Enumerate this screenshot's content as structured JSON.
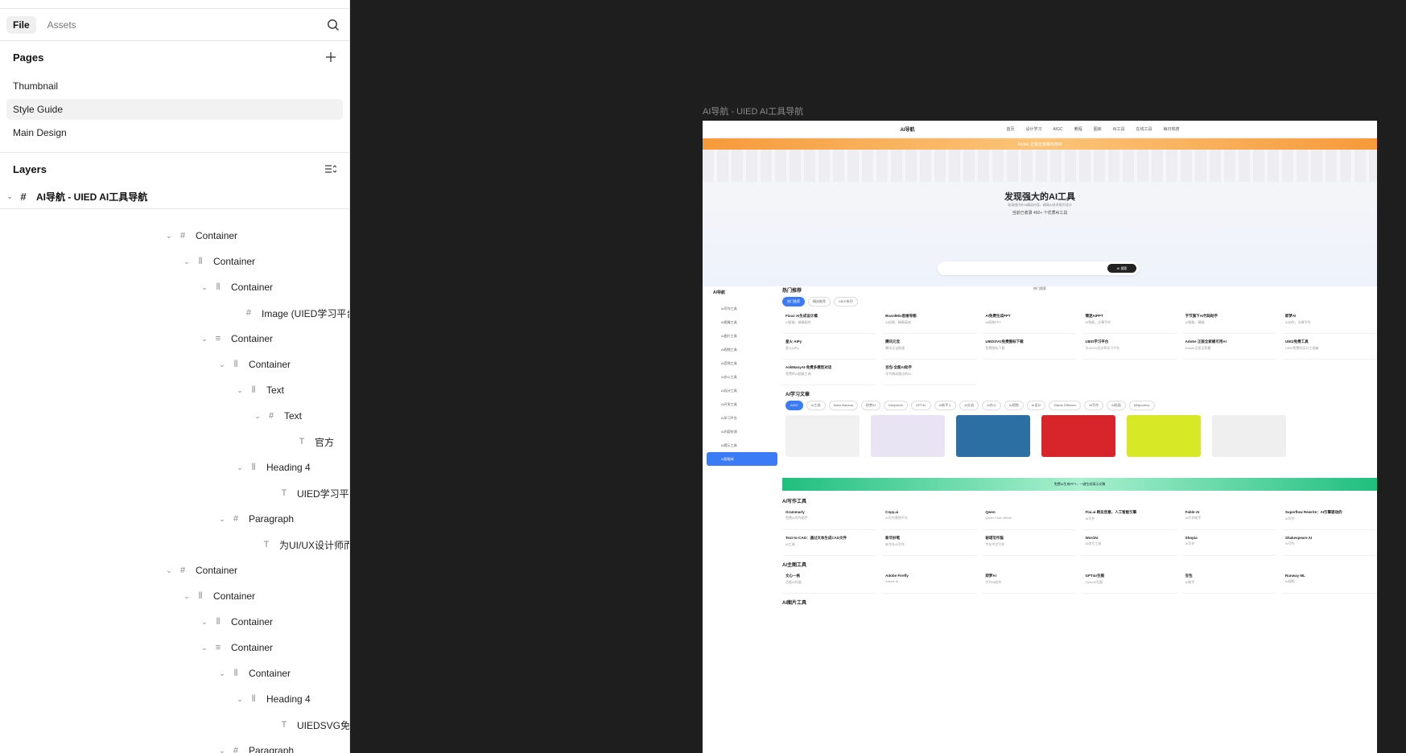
{
  "sidebar": {
    "tabs": [
      {
        "label": "File",
        "active": true
      },
      {
        "label": "Assets",
        "active": false
      }
    ],
    "pages": {
      "title": "Pages",
      "items": [
        {
          "label": "Thumbnail",
          "active": false
        },
        {
          "label": "Style Guide",
          "active": true
        },
        {
          "label": "Main Design",
          "active": false
        }
      ]
    },
    "layers": {
      "title": "Layers",
      "root": "AI导航 - UIED AI工具导航",
      "rows": [
        {
          "label": "Container",
          "icon": "frame-icon"
        },
        {
          "label": "Container",
          "icon": "autolayout-h-icon"
        },
        {
          "label": "Container",
          "icon": "autolayout-h-icon"
        },
        {
          "label": "Image (UIED学习平台",
          "icon": "frame-icon"
        },
        {
          "label": "Container",
          "icon": "autolayout-v-icon"
        },
        {
          "label": "Container",
          "icon": "autolayout-h-icon"
        },
        {
          "label": "Text",
          "icon": "autolayout-h-icon"
        },
        {
          "label": "Text",
          "icon": "frame-icon"
        },
        {
          "label": "官方",
          "icon": "text-icon"
        },
        {
          "label": "Heading 4",
          "icon": "autolayout-h-icon"
        },
        {
          "label": "UIED学习平",
          "icon": "text-icon"
        },
        {
          "label": "Paragraph",
          "icon": "frame-icon"
        },
        {
          "label": "为UI/UX设计师而",
          "icon": "text-icon"
        },
        {
          "label": "Container",
          "icon": "frame-icon"
        },
        {
          "label": "Container",
          "icon": "autolayout-h-icon"
        },
        {
          "label": "Container",
          "icon": "autolayout-h-icon"
        },
        {
          "label": "Container",
          "icon": "autolayout-v-icon"
        },
        {
          "label": "Container",
          "icon": "autolayout-h-icon"
        },
        {
          "label": "Heading 4",
          "icon": "autolayout-h-icon"
        },
        {
          "label": "UIEDSVG免",
          "icon": "text-icon"
        },
        {
          "label": "Paragraph",
          "icon": "frame-icon"
        }
      ]
    }
  },
  "canvas": {
    "frame_label": "AI导航 - UIED AI工具导航",
    "site": {
      "logo": "AI导航",
      "nav": [
        "首页",
        "设计学习",
        "AIGC",
        "教程",
        "图库",
        "AI工具",
        "在线工具",
        "每日热搜"
      ],
      "banner": "Adobe 正版全家桶可用AI",
      "hero_title": "发现强大的AI工具",
      "hero_sub": "收录国内外AI精选内容，精致AI技术助力设计",
      "hero_count": "当前已收录 492+ 个优质AI工具",
      "search_btn": "AI 搜索",
      "hot_label": "热门搜索",
      "side_title": "AI导航",
      "side_items": [
        "AI写作工具",
        "AI图像工具",
        "AI图片工具",
        "AI视频工具",
        "AI音频工具",
        "AI办公工具",
        "AI设计工具",
        "AI开发工具",
        "AI学习平台",
        "AI内容检测",
        "AI提示工具",
        "AI智能体"
      ],
      "sec_hot": "热门推荐",
      "sec_hot_chips": [
        "热门推荐",
        "精选推荐",
        "UIED系列"
      ],
      "hot_cards": [
        {
          "t": "Fixxo AI生成设计稿",
          "d": "AI智能，精确配色"
        },
        {
          "t": "BoardMix思维导图",
          "d": "AI创建，精确高效"
        },
        {
          "t": "AI免费生成PPT",
          "d": "AI高效PPT"
        },
        {
          "t": "情迷AIPPT",
          "d": "AI智能，文章写作"
        },
        {
          "t": "字节旗下AI代码助手",
          "d": "AI智能，精确"
        },
        {
          "t": "即梦AI",
          "d": "AI创作，文章写作"
        },
        {
          "t": "星火 AIPy",
          "d": "星火AIPy"
        },
        {
          "t": "腾讯元宝",
          "d": "腾讯元宝助理"
        },
        {
          "t": "UIEDSVG免费图标下载",
          "d": "免费图标下载"
        },
        {
          "t": "UIED学习平台",
          "d": "为UI/UX设计师学习平台"
        },
        {
          "t": "Adobe 正版全家桶可用AI",
          "d": "Adobe正版全家桶"
        },
        {
          "t": "UIED免费工具",
          "d": "UIED免费的设计工具箱"
        },
        {
          "t": "AskManyAI-免费多模型对话",
          "d": "免费的AI超级工具"
        },
        {
          "t": "豆包-全能AI助手",
          "d": "字节跳动推出的AI"
        }
      ],
      "sec_learn": "AI学习文章",
      "sec_learn_chips": [
        "AIGC",
        "AI工具",
        "Nano Banana",
        "即梦AI",
        "Deepseek",
        "GPT4o",
        "AI新手入",
        "AI交流",
        "AI办公",
        "AI视频",
        "AI设计",
        "Stable Diffusion",
        "AI写作",
        "AI绘画",
        "Midjourney"
      ],
      "thumb_colors": [
        "#f1f1f1",
        "#e8e4f4",
        "#2c6fa3",
        "#d8252b",
        "#d7e826",
        "#efefef"
      ],
      "green_banner": "免费AI生成PPT，一键生成演示文稿",
      "sec_write": "AI写作工具",
      "write_cards": [
        {
          "t": "Grammarly",
          "d": "免费AI写作助手"
        },
        {
          "t": "Copy.ai",
          "d": "AI写作营销平台"
        },
        {
          "t": "Qwen",
          "d": "Qwen Chat official"
        },
        {
          "t": "Flai.ai·跨友创意、人工智能引擎",
          "d": "AI写作"
        },
        {
          "t": "Fable·AI",
          "d": "AI写作助手"
        },
        {
          "t": "Superflow Rewrite：AI引擎驱动的",
          "d": "AI写作"
        },
        {
          "t": "Text-to-CAD：通过文本生成CAD文件",
          "d": "AI工具"
        },
        {
          "t": "新华妙笔",
          "d": "新华社AI写作"
        },
        {
          "t": "秘塔写作猫",
          "d": "专业中文写作"
        },
        {
          "t": "WordAI",
          "d": "AI改写工具"
        },
        {
          "t": "Shopia",
          "d": "AI写作"
        },
        {
          "t": "Shakespeare AI",
          "d": "AI写作"
        }
      ],
      "sec_image": "AI主图工具",
      "image_cards": [
        {
          "t": "文心一格",
          "d": "百度AI作画"
        },
        {
          "t": "Adobe Firefly",
          "d": "Adobe AI"
        },
        {
          "t": "即梦AI",
          "d": "字节AI创作"
        },
        {
          "t": "GPT4o生图",
          "d": "OpenAI生图"
        },
        {
          "t": "豆包",
          "d": "AI助手"
        },
        {
          "t": "Runway ML",
          "d": "AI视频"
        }
      ],
      "sec_pic": "AI图片工具"
    }
  }
}
